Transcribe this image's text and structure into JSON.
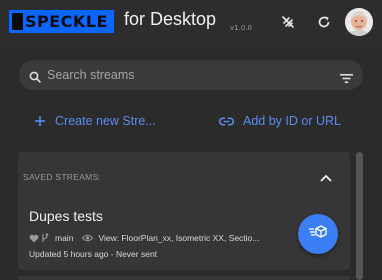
{
  "header": {
    "brand": "SPECKLE",
    "title": "for Desktop",
    "version": "v1.0.0",
    "icons": [
      "sync-disabled-icon",
      "refresh-icon",
      "user-avatar"
    ]
  },
  "search": {
    "placeholder": "Search streams",
    "value": ""
  },
  "actions": {
    "create_label": "Create new Stre...",
    "add_label": "Add by ID or URL"
  },
  "saved_streams": {
    "label": "SAVED STREAMS:",
    "items": [
      {
        "name": "Dupes tests",
        "branch": "main",
        "view": "View: FloorPlan_xx, Isometric XX, Sectio...",
        "updated": "Updated 5 hours ago - Never sent"
      }
    ]
  },
  "colors": {
    "accent": "#5a8cf2",
    "brand": "#0a66ff",
    "fab": "#3b7ef5",
    "background": "#2b2b2b",
    "panel": "#363636"
  }
}
